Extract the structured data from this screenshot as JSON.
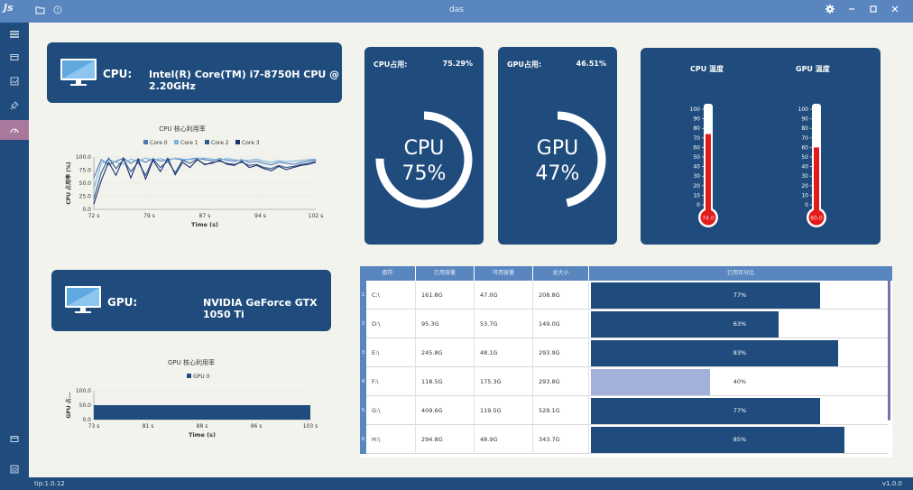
{
  "window": {
    "title": "das",
    "logo_text": "Js",
    "status_left": "tip:1.0.12",
    "status_right": "v1.0.0"
  },
  "cpu_info": {
    "label": "CPU:",
    "model": "Intel(R) Core(TM) i7-8750H CPU @ 2.20GHz"
  },
  "gpu_info": {
    "label": "GPU:",
    "model": "NVIDIA GeForce GTX 1050 Ti"
  },
  "cpu_usage": {
    "label": "CPU占用:",
    "percent_text": "75.29%",
    "gauge_label": "CPU",
    "gauge_value_text": "75%",
    "value": 75.29
  },
  "gpu_usage": {
    "label": "GPU占用:",
    "percent_text": "46.51%",
    "gauge_label": "GPU",
    "gauge_value_text": "47%",
    "value": 46.51
  },
  "temperature": {
    "cpu_title": "CPU 温度",
    "gpu_title": "GPU  温度",
    "cpu_value": 74.0,
    "gpu_value": 60.0,
    "cpu_bulb_text": "74.0",
    "gpu_bulb_text": "60.0",
    "scale_ticks": [
      "100",
      "90",
      "80",
      "70",
      "60",
      "50",
      "40",
      "30",
      "20",
      "10",
      "0"
    ],
    "fill_color": "#e31b1b"
  },
  "disk_table": {
    "headers": [
      "盘符",
      "已用容量",
      "可用容量",
      "总大小",
      "已用百分比"
    ],
    "rows": [
      {
        "num": "1",
        "drive": "C:\\",
        "used": "161.8G",
        "free": "47.0G",
        "total": "208.8G",
        "pct_text": "77%",
        "pct": 77
      },
      {
        "num": "2",
        "drive": "D:\\",
        "used": "95.3G",
        "free": "53.7G",
        "total": "149.0G",
        "pct_text": "63%",
        "pct": 63
      },
      {
        "num": "3",
        "drive": "E:\\",
        "used": "245.8G",
        "free": "48.1G",
        "total": "293.9G",
        "pct_text": "83%",
        "pct": 83
      },
      {
        "num": "4",
        "drive": "F:\\",
        "used": "118.5G",
        "free": "175.3G",
        "total": "293.8G",
        "pct_text": "40%",
        "pct": 40
      },
      {
        "num": "5",
        "drive": "G:\\",
        "used": "409.6G",
        "free": "119.5G",
        "total": "529.1G",
        "pct_text": "77%",
        "pct": 77
      },
      {
        "num": "6",
        "drive": "H:\\",
        "used": "294.8G",
        "free": "48.9G",
        "total": "343.7G",
        "pct_text": "85%",
        "pct": 85
      }
    ]
  },
  "chart_data": [
    {
      "type": "line",
      "title": "CPU 核心利用率",
      "xlabel": "Time (s)",
      "ylabel": "CPU 占用率 (%)",
      "x_ticks": [
        "72 s",
        "79 s",
        "87 s",
        "94 s",
        "102 s"
      ],
      "y_ticks": [
        "100.0",
        "75.0",
        "50.0",
        "25.0",
        "0.0"
      ],
      "xlim": [
        72,
        102
      ],
      "ylim": [
        0,
        100
      ],
      "grid": true,
      "legend": "top",
      "series": [
        {
          "name": "Core 0",
          "color": "#4e79b8",
          "x": [
            72,
            73,
            74,
            75,
            76,
            77,
            78,
            79,
            80,
            81,
            82,
            83,
            84,
            85,
            86,
            87,
            88,
            89,
            90,
            91,
            92,
            93,
            94,
            95,
            96,
            97,
            98,
            99,
            100,
            101,
            102
          ],
          "y": [
            60,
            95,
            85,
            92,
            98,
            88,
            96,
            90,
            97,
            92,
            95,
            97,
            94,
            96,
            98,
            95,
            93,
            97,
            94,
            92,
            95,
            90,
            92,
            88,
            85,
            90,
            88,
            86,
            90,
            92,
            95
          ]
        },
        {
          "name": "Core 1",
          "color": "#7ab3df",
          "x": [
            72,
            73,
            74,
            75,
            76,
            77,
            78,
            79,
            80,
            81,
            82,
            83,
            84,
            85,
            86,
            87,
            88,
            89,
            90,
            91,
            92,
            93,
            94,
            95,
            96,
            97,
            98,
            99,
            100,
            101,
            102
          ],
          "y": [
            40,
            88,
            95,
            90,
            86,
            96,
            92,
            98,
            94,
            97,
            93,
            98,
            96,
            95,
            97,
            98,
            96,
            94,
            97,
            95,
            93,
            94,
            96,
            92,
            90,
            93,
            91,
            92,
            94,
            95,
            96
          ]
        },
        {
          "name": "Core 2",
          "color": "#2e5d8f",
          "x": [
            72,
            73,
            74,
            75,
            76,
            77,
            78,
            79,
            80,
            81,
            82,
            83,
            84,
            85,
            86,
            87,
            88,
            89,
            90,
            91,
            92,
            93,
            94,
            95,
            96,
            97,
            98,
            99,
            100,
            101,
            102
          ],
          "y": [
            20,
            70,
            98,
            78,
            95,
            72,
            90,
            65,
            96,
            80,
            92,
            70,
            94,
            88,
            96,
            85,
            90,
            92,
            88,
            86,
            90,
            84,
            86,
            80,
            78,
            84,
            80,
            82,
            86,
            88,
            92
          ]
        },
        {
          "name": "Core 3",
          "color": "#1c2f6e",
          "x": [
            72,
            73,
            74,
            75,
            76,
            77,
            78,
            79,
            80,
            81,
            82,
            83,
            84,
            85,
            86,
            87,
            88,
            89,
            90,
            91,
            92,
            93,
            94,
            95,
            96,
            97,
            98,
            99,
            100,
            101,
            102
          ],
          "y": [
            10,
            55,
            90,
            65,
            98,
            60,
            96,
            58,
            94,
            72,
            98,
            66,
            90,
            80,
            95,
            86,
            88,
            94,
            86,
            84,
            92,
            80,
            84,
            78,
            74,
            82,
            76,
            80,
            84,
            86,
            90
          ]
        }
      ]
    },
    {
      "type": "area",
      "title": "GPU 核心利用率",
      "xlabel": "Time (s)",
      "ylabel": "GPU 占...",
      "x_ticks": [
        "73 s",
        "81 s",
        "88 s",
        "96 s",
        "103 s"
      ],
      "y_ticks": [
        "100.0",
        "50.0",
        "0.0"
      ],
      "xlim": [
        73,
        103
      ],
      "ylim": [
        0,
        100
      ],
      "grid": true,
      "legend": "top",
      "series": [
        {
          "name": "GPU 0",
          "color": "#1f4c7c",
          "x": [
            73,
            103
          ],
          "y": [
            50,
            50
          ]
        }
      ]
    }
  ]
}
